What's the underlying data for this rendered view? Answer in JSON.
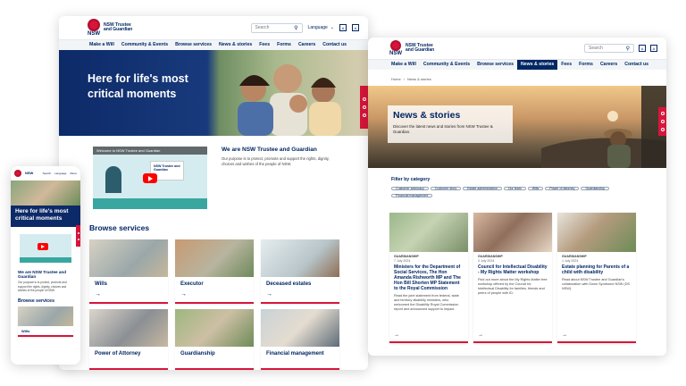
{
  "brand": {
    "nsw": "NSW",
    "org_line1": "NSW Trustee",
    "org_line2": "and Guardian"
  },
  "header": {
    "search_placeholder": "Search",
    "language": "Language",
    "a11y_a": "A",
    "a11y_b": "A"
  },
  "nav": {
    "items": [
      "Make a Will",
      "Community & Events",
      "Browse services",
      "News & stories",
      "Fees",
      "Forms",
      "Careers",
      "Contact us"
    ]
  },
  "home": {
    "hero_title": "Here for life's most critical moments",
    "video_title": "Welcome to NSW Trustee and Guardian",
    "video_brand": "NSW Trustee and Guardian",
    "intro_heading": "We are NSW Trustee and Guardian",
    "intro_text": "Our purpose is to protect, promote and support the rights, dignity, choices and wishes of the people of NSW.",
    "browse_heading": "Browse services",
    "services": [
      "Wills",
      "Executor",
      "Deceased estates",
      "Power of Attorney",
      "Guardianship",
      "Financial management"
    ],
    "arrow": "→"
  },
  "mobile": {
    "hero_title": "Here for life's most critical moments",
    "intro_heading": "We are NSW Trustee and Guardian",
    "intro_text": "Our purpose is to protect, promote and support the rights, dignity, choices and wishes of the people of NSW.",
    "browse_heading": "Browse services",
    "service": "Wills",
    "menu_items": [
      "Search",
      "Language",
      "Menu"
    ]
  },
  "news_page": {
    "breadcrumb_home": "Home",
    "breadcrumb_sep": "›",
    "breadcrumb_current": "News & stories",
    "hero_title": "News & stories",
    "hero_desc": "Discover the latest news and stories from NSW Trustee & Guardian.",
    "filter_heading": "Filter by category",
    "filters": [
      "Customer advocacy",
      "Customer story",
      "Estate administration",
      "Our team",
      "Wills",
      "Power of attorney",
      "Guardianship",
      "Financial management"
    ],
    "articles": [
      {
        "category": "GUARDIANSHIP",
        "date": "7 July 2024",
        "title": "Ministers for the Department of Social Services, The Hon Amanda Rishworth MP and The Hon Bill Shorten MP Statement to the Royal Commission",
        "desc": "Read the joint statement from federal, state and territory disability ministers, who welcomed the Disability Royal Commission report and announced support to impact."
      },
      {
        "category": "GUARDIANSHIP",
        "date": "3 July 2024",
        "title": "Council for Intellectual Disability - My Rights Matter workshop",
        "desc": "Find out more about the My Rights Matter free workshop offered by the Council for Intellectual Disability for families, friends and peers of people with ID."
      },
      {
        "category": "GUARDIANSHIP",
        "date": "1 July 2024",
        "title": "Estate planning for Parents of a child with disability",
        "desc": "Read about NSW Trustee and Guardian's collaboration with Down Syndrome NSW (DS NSW)."
      }
    ]
  },
  "colors": {
    "navy": "#002664",
    "red": "#d7153a",
    "light": "#f2f5f8"
  }
}
